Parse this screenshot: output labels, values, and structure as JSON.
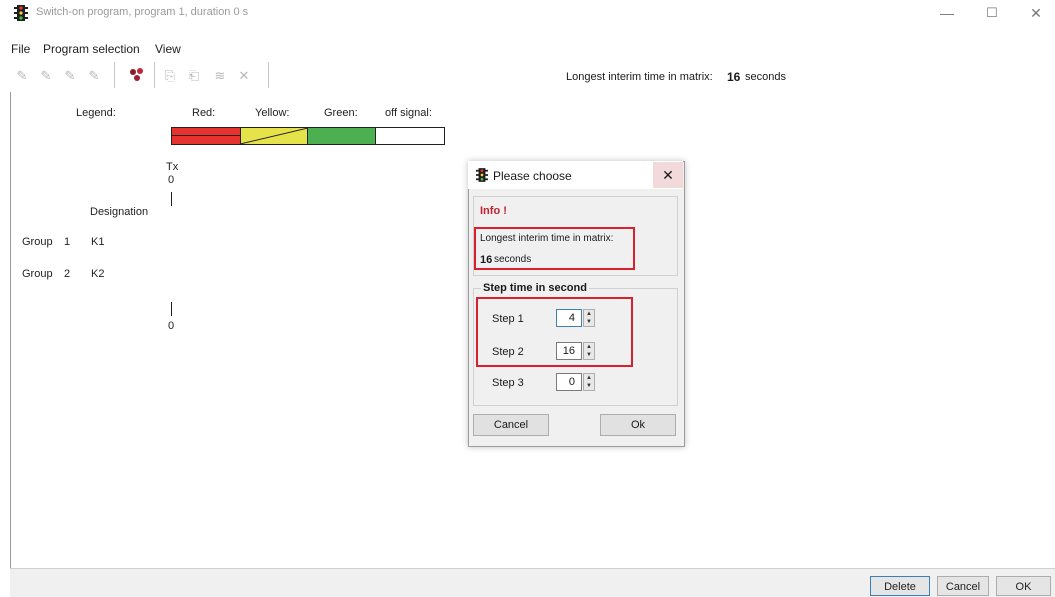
{
  "window": {
    "title": "Switch-on program, program 1, duration 0 s",
    "controls": {
      "minimize": "—",
      "maximize": "☐",
      "close": "✕"
    }
  },
  "menu": {
    "items": [
      "File",
      "Program selection",
      "View"
    ]
  },
  "toolbar": {
    "interim_label": "Longest interim time in matrix:",
    "interim_value": "16",
    "interim_unit": "seconds",
    "icons": [
      "pencil-icon",
      "pencil-icon",
      "pencil-icon",
      "pencil-icon",
      "traffic-signal-icon",
      "copy-icon",
      "paste-icon",
      "delete-icon",
      "cross-icon"
    ]
  },
  "legend": {
    "title": "Legend:",
    "red": "Red:",
    "yellow": "Yellow:",
    "green": "Green:",
    "off": "off signal:",
    "colors": {
      "red": "#e8322e",
      "yellow": "#e6e24a",
      "green": "#4caf50",
      "off": "#ffffff"
    }
  },
  "timeline": {
    "top_label": "Tx",
    "top_value": "0",
    "bottom_value": "0"
  },
  "designation_header": "Designation",
  "groups": [
    {
      "label": "Group",
      "number": "1",
      "designation": "K1"
    },
    {
      "label": "Group",
      "number": "2",
      "designation": "K2"
    }
  ],
  "status": {
    "delete": "Delete",
    "cancel": "Cancel",
    "ok": "OK"
  },
  "dialog": {
    "title": "Please choose",
    "info_heading": "Info !",
    "info_text": "Longest interim time in matrix:",
    "info_value": "16",
    "info_unit": "seconds",
    "step_group": "Step time in second",
    "steps": [
      {
        "label": "Step 1",
        "value": "4"
      },
      {
        "label": "Step 2",
        "value": "16"
      },
      {
        "label": "Step 3",
        "value": "0"
      }
    ],
    "cancel": "Cancel",
    "ok": "Ok"
  }
}
